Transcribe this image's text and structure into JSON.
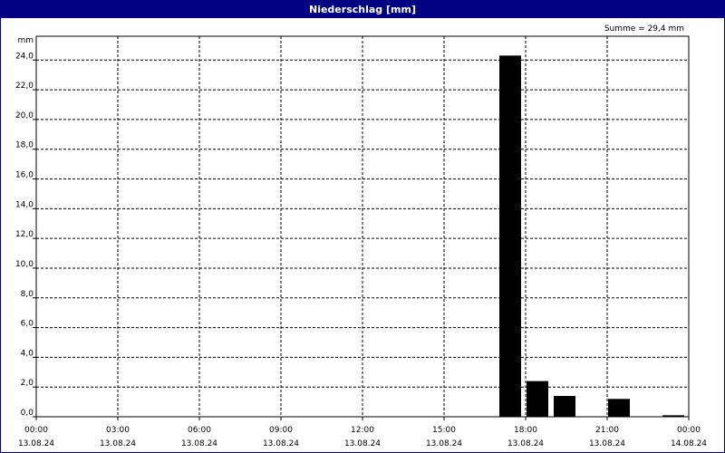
{
  "window": {
    "title": "Niederschlag [mm]"
  },
  "chart_data": {
    "type": "bar",
    "title": "Niederschlag [mm]",
    "ylabel": "mm",
    "xlabel": "",
    "annotation": "Summe = 29,4 mm",
    "ylim": [
      0,
      25.6
    ],
    "xlim": [
      "13.08.24 00:00",
      "14.08.24 00:00"
    ],
    "y_ticks": [
      {
        "value": 0,
        "label": "0,0"
      },
      {
        "value": 2,
        "label": "2,0"
      },
      {
        "value": 4,
        "label": "4,0"
      },
      {
        "value": 6,
        "label": "6,0"
      },
      {
        "value": 8,
        "label": "8,0"
      },
      {
        "value": 10,
        "label": "10,0"
      },
      {
        "value": 12,
        "label": "12,0"
      },
      {
        "value": 14,
        "label": "14,0"
      },
      {
        "value": 16,
        "label": "16,0"
      },
      {
        "value": 18,
        "label": "18,0"
      },
      {
        "value": 20,
        "label": "20,0"
      },
      {
        "value": 22,
        "label": "22,0"
      },
      {
        "value": 24,
        "label": "24,0"
      }
    ],
    "x_ticks": [
      {
        "time": "00:00",
        "date": "13.08.24"
      },
      {
        "time": "03:00",
        "date": "13.08.24"
      },
      {
        "time": "06:00",
        "date": "13.08.24"
      },
      {
        "time": "09:00",
        "date": "13.08.24"
      },
      {
        "time": "12:00",
        "date": "13.08.24"
      },
      {
        "time": "15:00",
        "date": "13.08.24"
      },
      {
        "time": "18:00",
        "date": "13.08.24"
      },
      {
        "time": "21:00",
        "date": "13.08.24"
      },
      {
        "time": "00:00",
        "date": "14.08.24"
      }
    ],
    "grid": true,
    "bar_color": "#000000",
    "series": [
      {
        "x": [
          "13.08.24 17:00",
          "13.08.24 18:00",
          "13.08.24 19:00",
          "13.08.24 20:00",
          "13.08.24 21:00",
          "13.08.24 22:00",
          "13.08.24 23:00"
        ],
        "values": [
          24.3,
          2.4,
          1.4,
          0.0,
          1.2,
          0.0,
          0.1
        ]
      }
    ]
  }
}
